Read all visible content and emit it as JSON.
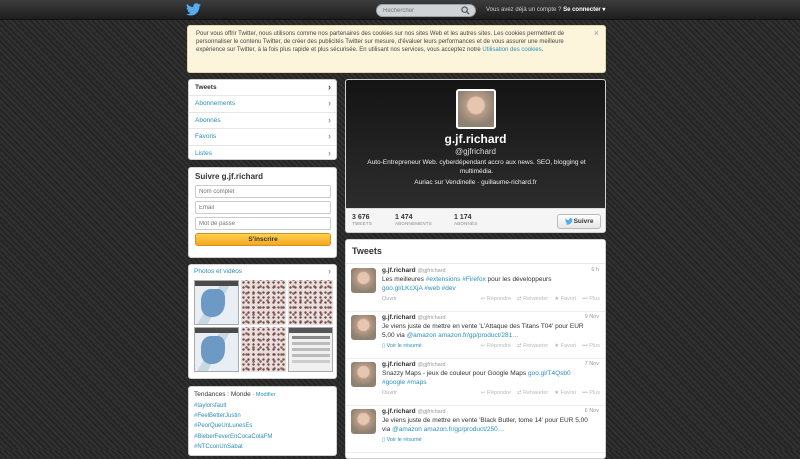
{
  "topbar": {
    "search_placeholder": "Rechercher",
    "account_question": "Vous avez déjà un compte ?",
    "login_label": "Se connecter ▾"
  },
  "cookie": {
    "text": "Pour vous offrir Twitter, nous utilisons comme nos partenaires des cookies sur nos sites Web et les autres sites. Les cookies permettent de personnaliser le contenu Twitter, de créer des publicités Twitter sur mesure, d'évaluer leurs performances et de vous assurer une meilleure expérience sur Twitter, à la fois plus rapide et plus sécurisée. En utilisant nos services, vous acceptez notre ",
    "link": "Utilisation des cookies",
    "after": ".",
    "close": "×"
  },
  "nav": {
    "items": [
      {
        "label": "Tweets"
      },
      {
        "label": "Abonnements"
      },
      {
        "label": "Abonnés"
      },
      {
        "label": "Favoris"
      },
      {
        "label": "Listes"
      }
    ]
  },
  "signup": {
    "title": "Suivre g.jf.richard",
    "name_placeholder": "Nom complet",
    "email_placeholder": "Email",
    "password_placeholder": "Mot de passe",
    "button": "S'inscrire"
  },
  "photos": {
    "title": "Photos et vidéos"
  },
  "trends": {
    "title": "Tendances : Monde",
    "change": "· Modifier",
    "items": [
      "#taylorsfault",
      "#FeelBetterJustin",
      "#PeorQueUnLunesEs",
      "#BieberFeverEnCocaColaFM",
      "#NTCconUnSabat"
    ]
  },
  "profile": {
    "name": "g.jf.richard",
    "handle": "@gjfrichard",
    "bio": "Auto-Entrepreneur Web. cyberdépendant accro aux news. SEO, blogging et multimédia.",
    "location": "Auriac sur Vendinelle",
    "url": "guillaume-richard.fr",
    "stats": [
      {
        "num": "3 676",
        "label": "TWEETS"
      },
      {
        "num": "1 474",
        "label": "ABONNEMENTS"
      },
      {
        "num": "1 174",
        "label": "ABONNÉS"
      }
    ],
    "follow": "Suivre"
  },
  "tweets": {
    "title": "Tweets",
    "actions": {
      "reply": "↩ Répondre",
      "retweet": "⇄ Retweeter",
      "fav": "★ Favori",
      "more": "••• Plus"
    },
    "items": [
      {
        "name": "g.jf.richard",
        "handle": "@gjfrichard",
        "date": "6 h",
        "parts": [
          "Les meilleures ",
          "#extensions #Firefox",
          " pour les développeurs ",
          "goo.gl/LKcXjA",
          " ",
          "#web #dev"
        ],
        "footer": "Ouvrir"
      },
      {
        "name": "g.jf.richard",
        "handle": "@gjfrichard",
        "date": "9 Nov",
        "parts": [
          "Je viens juste de mettre en vente 'L'Attaque des Titans T04' pour EUR 5,00 via ",
          "@amazon",
          " ",
          "amazon.fr/gp/product/281…",
          "",
          ""
        ],
        "footer": "Voir le résumé"
      },
      {
        "name": "g.jf.richard",
        "handle": "@gjfrichard",
        "date": "7 Nov",
        "parts": [
          "Snazzy Maps - jeux de couleur pour Google Maps ",
          "goo.gl/T4Qsb0",
          " ",
          "#google #maps",
          "",
          ""
        ],
        "footer": "Ouvrir"
      },
      {
        "name": "g.jf.richard",
        "handle": "@gjfrichard",
        "date": "6 Nov",
        "parts": [
          "Je viens juste de mettre en vente 'Black Butler, tome 14' pour EUR 5,00 via ",
          "@amazon",
          " ",
          "amazon.fr/gp/product/250…",
          "",
          ""
        ],
        "footer": "Voir le résumé"
      }
    ]
  }
}
